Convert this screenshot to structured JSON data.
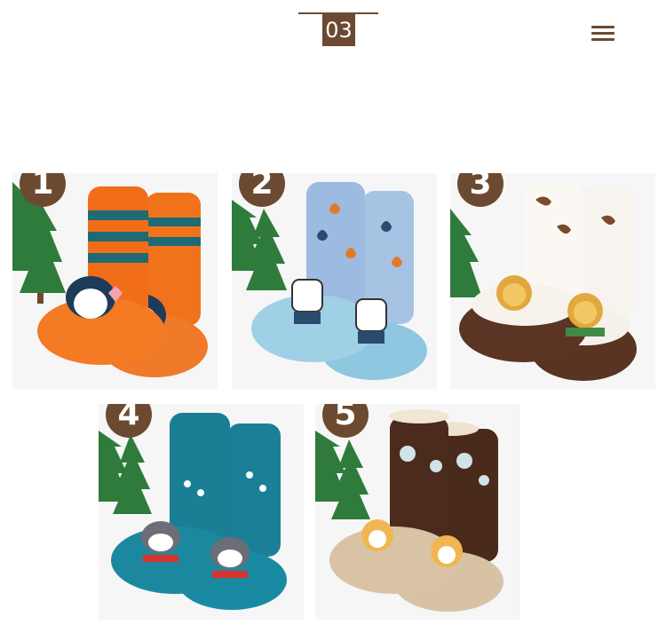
{
  "header": {
    "section_number": "03"
  },
  "menu": {
    "icon": "hamburger-menu-icon"
  },
  "colors": {
    "brand_brown": "#6b4a31",
    "tree_green": "#2f7b3c"
  },
  "products": [
    {
      "number": "1",
      "character": "penguin",
      "sock_color": "#f0731c",
      "stripe_color": "#1e6a75",
      "sole_color": "#f07a2a"
    },
    {
      "number": "2",
      "character": "zebra",
      "sock_color": "#a7c3e3",
      "accent_color": "#e07a2a",
      "sole_color": "#8ec7e0"
    },
    {
      "number": "3",
      "character": "lion",
      "sock_color": "#f7f4ef",
      "accent_color": "#7a4a2c",
      "sole_color": "#5a3422"
    },
    {
      "number": "4",
      "character": "raccoon",
      "sock_color": "#1a7f95",
      "accent_color": "#ffffff",
      "sole_color": "#1a7f95"
    },
    {
      "number": "5",
      "character": "fox",
      "sock_color": "#4a2a1a",
      "accent_color": "#cfe3e8",
      "sole_color": "#d7c3a4"
    }
  ]
}
